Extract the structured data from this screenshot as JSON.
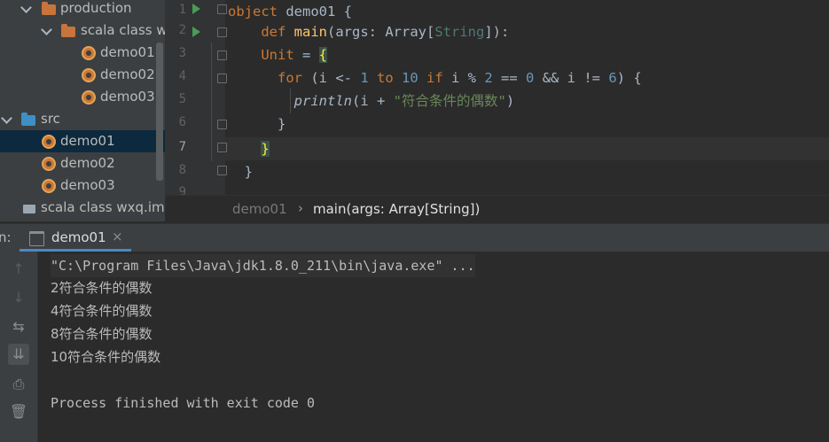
{
  "project_tree": {
    "items": [
      {
        "label": "production",
        "kind": "folder-orange"
      },
      {
        "label": "scala class wxq",
        "kind": "folder-orange"
      },
      {
        "label": "demo01",
        "kind": "object"
      },
      {
        "label": "demo02",
        "kind": "object"
      },
      {
        "label": "demo03",
        "kind": "object"
      },
      {
        "label": "src",
        "kind": "folder-blue"
      },
      {
        "label": "demo01",
        "kind": "object",
        "selected": true
      },
      {
        "label": "demo02",
        "kind": "object"
      },
      {
        "label": "demo03",
        "kind": "object"
      },
      {
        "label": "scala class wxq.iml",
        "kind": "file"
      }
    ]
  },
  "editor": {
    "line_numbers": [
      "1",
      "2",
      "3",
      "4",
      "5",
      "6",
      "7",
      "8",
      "9"
    ],
    "current_line": "7",
    "code_tokens": {
      "l1_kw": "object",
      "l1_rest": " demo01 {",
      "l2_kw": "def",
      "l2_fn": "main",
      "l2_a": "(args: Array[",
      "l2_tp": "String",
      "l2_b": "]):",
      "l3_ty": "Unit",
      "l3_eq": " = ",
      "l3_brace": "{",
      "l4_for": "for",
      "l4_a": " (i <- ",
      "l4_n1": "1",
      "l4_to": " to ",
      "l4_n2": "10",
      "l4_if": " if",
      "l4_b": " i % ",
      "l4_n3": "2",
      "l4_c": " == ",
      "l4_n4": "0",
      "l4_d": " && i != ",
      "l4_n5": "6",
      "l4_e": ") {",
      "l5_fn": "println",
      "l5_a": "(i + ",
      "l5_str": "\"符合条件的偶数\"",
      "l5_b": ")",
      "l6": "}",
      "l7": "}",
      "l8": "}"
    }
  },
  "breadcrumb": {
    "items": [
      "demo01",
      "main(args: Array[String])"
    ],
    "separator": "›"
  },
  "run_panel": {
    "header_label": "n:",
    "tab_label": "demo01",
    "tab_close": "×",
    "output_lines": [
      "\"C:\\Program Files\\Java\\jdk1.8.0_211\\bin\\java.exe\" ...",
      "2符合条件的偶数",
      "4符合条件的偶数",
      "8符合条件的偶数",
      "10符合条件的偶数",
      "",
      "Process finished with exit code 0"
    ],
    "side_icons": [
      "arrow-up-icon",
      "arrow-down-icon",
      "soft-wrap-icon",
      "scroll-to-end-icon",
      "print-icon",
      "trash-icon"
    ]
  },
  "colors": {
    "keyword": "#cc7832",
    "function": "#ffc66d",
    "number": "#6897bb",
    "string": "#6a8759",
    "run_arrow": "#499c54"
  }
}
